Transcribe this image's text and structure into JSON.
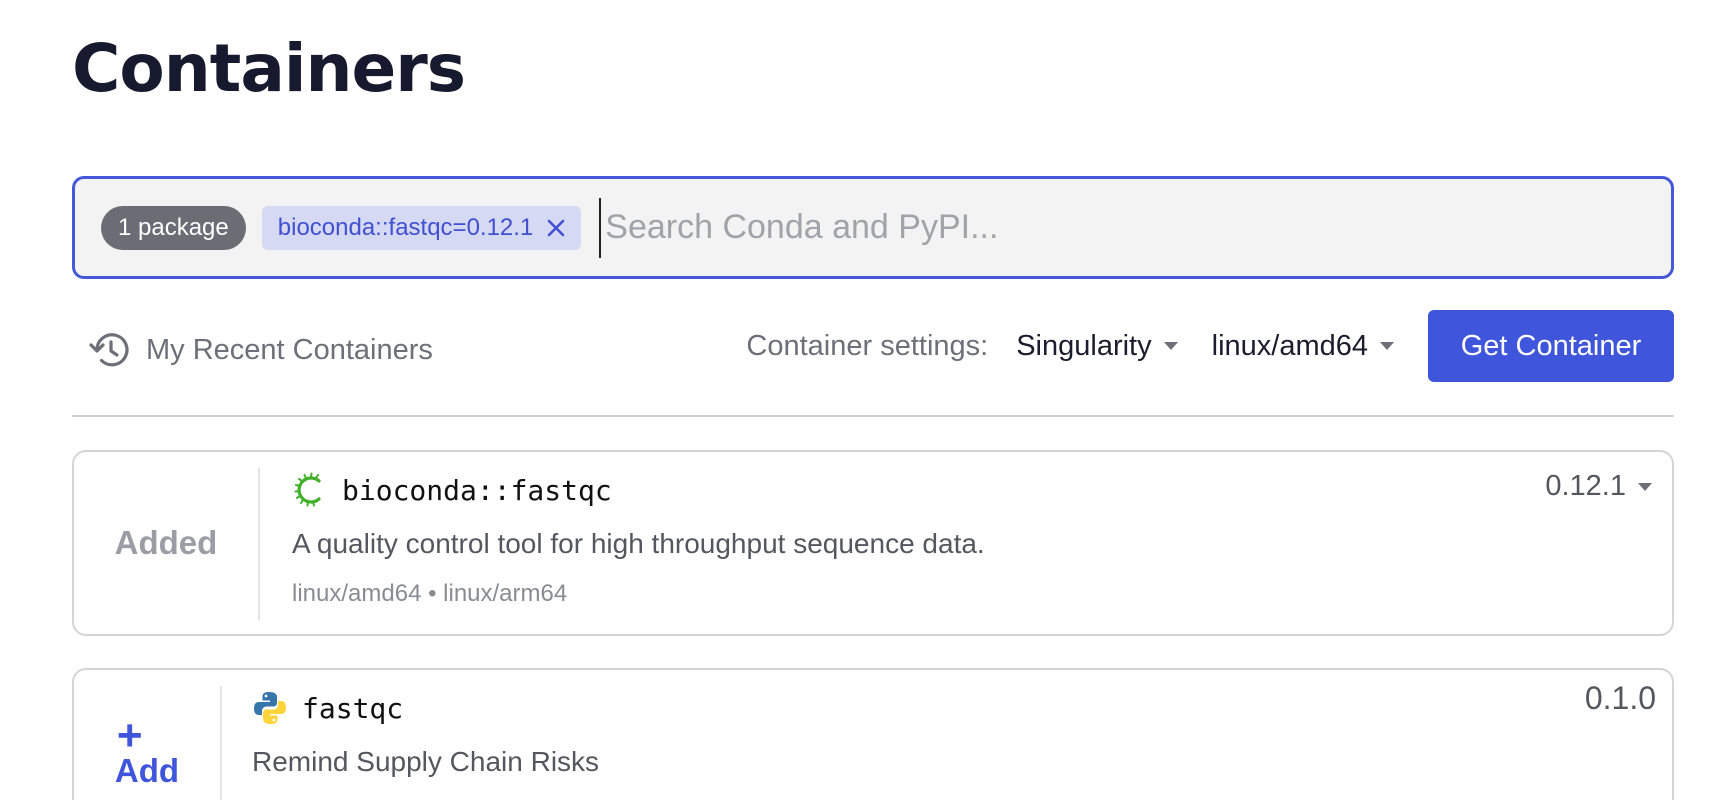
{
  "page": {
    "title": "Containers"
  },
  "search": {
    "package_count": "1 package",
    "chip_label": "bioconda::fastqc=0.12.1",
    "placeholder": "Search Conda and PyPI...",
    "value": ""
  },
  "toolbar": {
    "recent_label": "My Recent Containers",
    "settings_label": "Container settings:",
    "format_value": "Singularity",
    "platform_value": "linux/amd64",
    "get_button": "Get Container"
  },
  "results": [
    {
      "status": "Added",
      "name": "bioconda::fastqc",
      "source_icon": "conda-icon",
      "description": "A quality control tool for high throughput sequence data.",
      "platforms": "linux/amd64 • linux/arm64",
      "version": "0.12.1"
    },
    {
      "action_plus": "+",
      "action_label": "Add",
      "name": "fastqc",
      "source_icon": "python-icon",
      "description": "Remind Supply Chain Risks",
      "version": "0.1.0"
    }
  ],
  "colors": {
    "accent": "#3f56dc",
    "chip_bg": "#d5d9f4",
    "count_badge_bg": "#6b6c74",
    "conda_green": "#43b02a",
    "python_blue": "#3776ab",
    "python_yellow": "#ffd43b"
  }
}
